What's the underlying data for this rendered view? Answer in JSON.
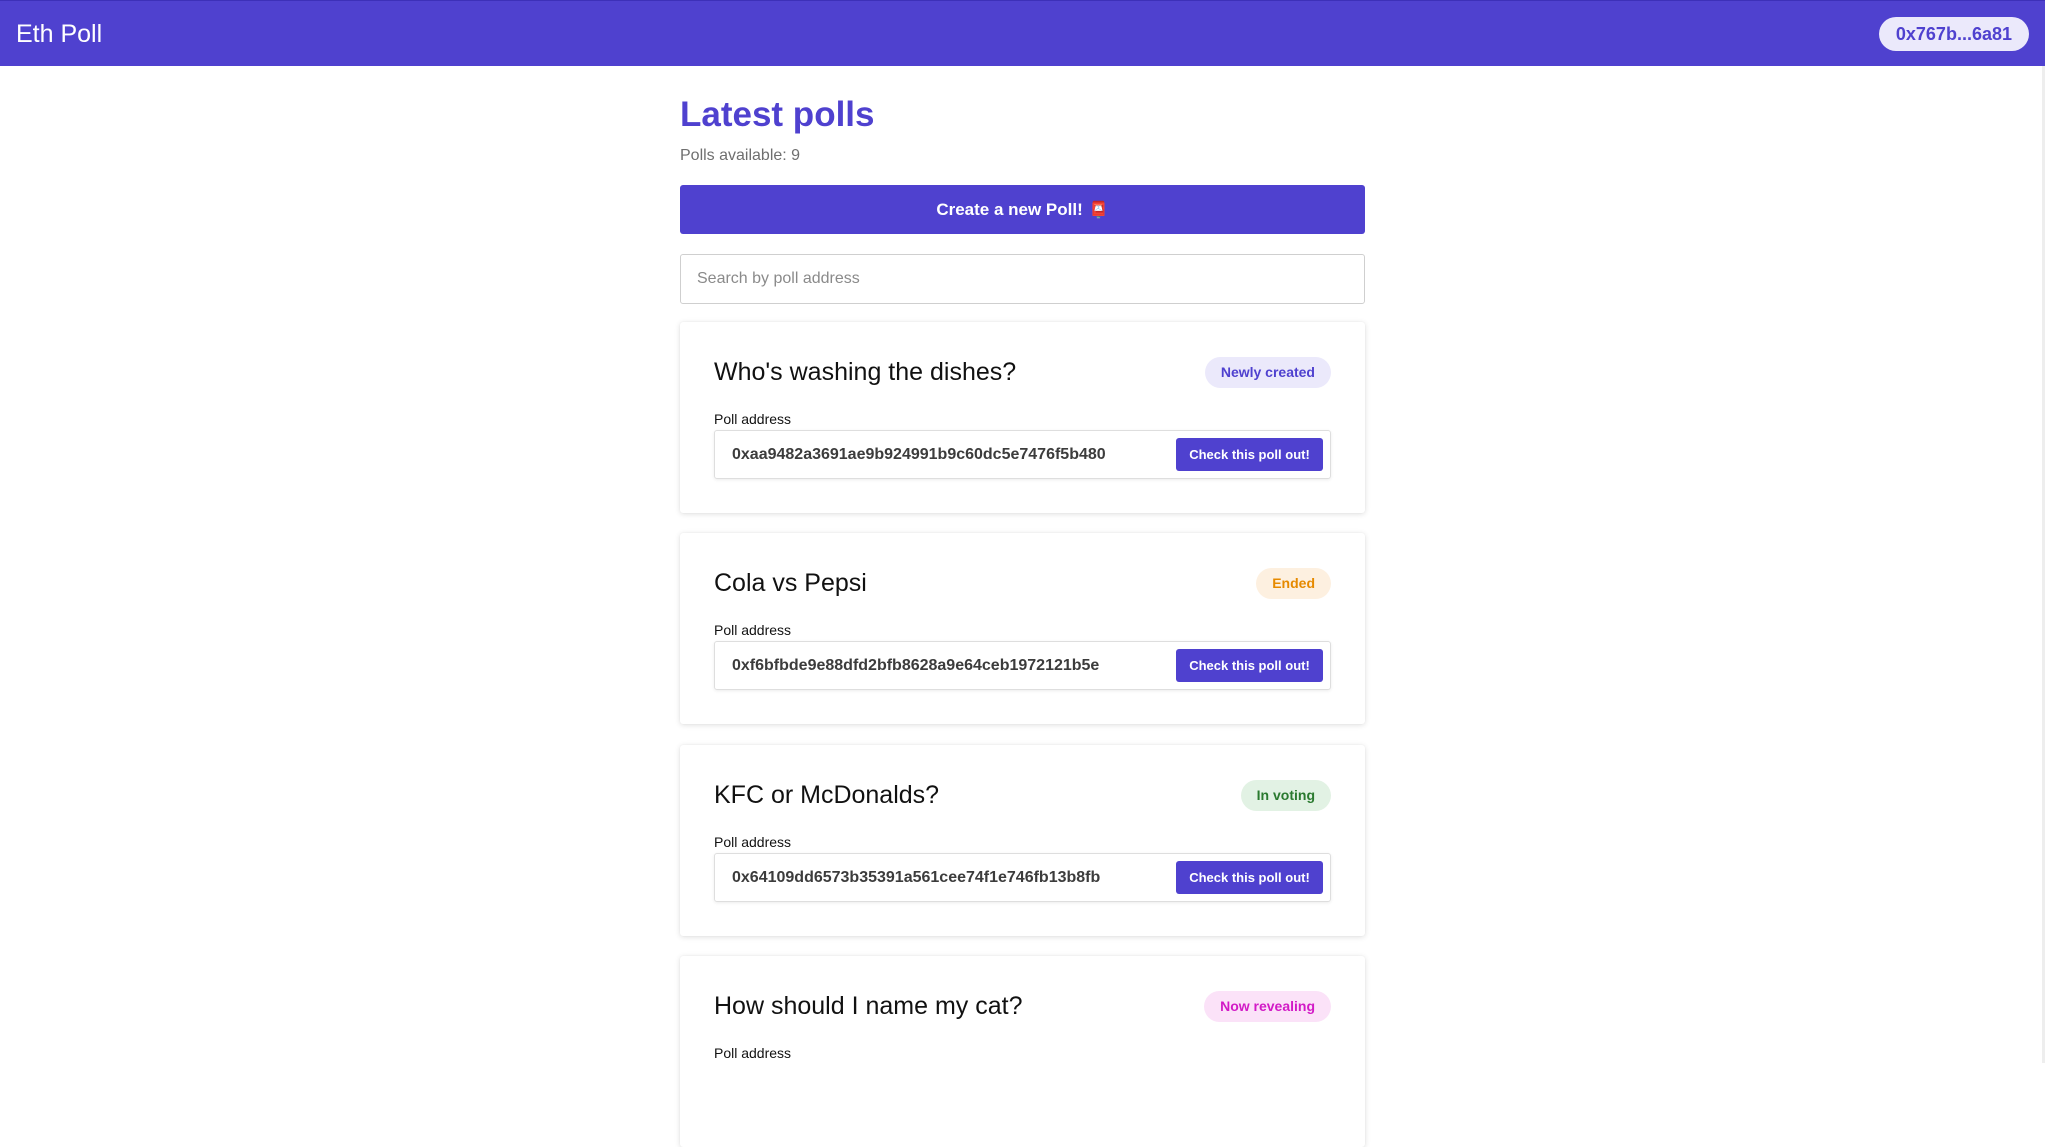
{
  "header": {
    "title": "Eth Poll",
    "wallet": "0x767b...6a81"
  },
  "main": {
    "title": "Latest polls",
    "polls_available": "Polls available: 9",
    "create_button": "Create a new Poll!",
    "create_icon": "ballot-box-emoji",
    "search_placeholder": "Search by poll address"
  },
  "colors": {
    "brand": "#4f41cf",
    "badge_new_bg": "#ebe9fb",
    "badge_new_fg": "#4f41cf",
    "badge_ended_bg": "#fdf0e0",
    "badge_ended_fg": "#e68a00",
    "badge_voting_bg": "#e2f2e4",
    "badge_voting_fg": "#2a7a2f",
    "badge_revealing_bg": "#fbe2f8",
    "badge_revealing_fg": "#d21ac6"
  },
  "polls": [
    {
      "title": "Who's washing the dishes?",
      "status": "Newly created",
      "address_label": "Poll address",
      "address": "0xaa9482a3691ae9b924991b9c60dc5e7476f5b480",
      "button": "Check this poll out!"
    },
    {
      "title": "Cola vs Pepsi",
      "status": "Ended",
      "address_label": "Poll address",
      "address": "0xf6bfbde9e88dfd2bfb8628a9e64ceb1972121b5e",
      "button": "Check this poll out!"
    },
    {
      "title": "KFC or McDonalds?",
      "status": "In voting",
      "address_label": "Poll address",
      "address": "0x64109dd6573b35391a561cee74f1e746fb13b8fb",
      "button": "Check this poll out!"
    },
    {
      "title": "How should I name my cat?",
      "status": "Now revealing",
      "address_label": "Poll address"
    }
  ]
}
